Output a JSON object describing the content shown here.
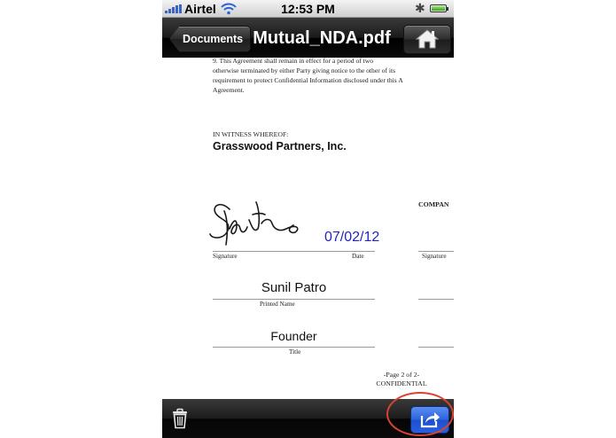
{
  "status_bar": {
    "carrier": "Airtel",
    "time": "12:53 PM"
  },
  "nav": {
    "back_label": "Documents",
    "title": "Mutual_NDA.pdf"
  },
  "document": {
    "clause_lines": [
      "9.        This Agreement shall remain in effect for a period of two",
      "otherwise terminated by either Party giving notice to the other of its",
      "requirement to protect Confidential Information disclosed under this A",
      "Agreement."
    ],
    "witness": "IN WITNESS WHEREOF:",
    "company": "Grasswood Partners, Inc.",
    "counterparty_label": "COMPAN",
    "signature_date": "07/02/12",
    "signature_label": "Signature",
    "date_label": "Date",
    "signature_label_right": "Signature",
    "printed_name": "Sunil Patro",
    "printed_name_label": "Printed Name",
    "title_value": "Founder",
    "title_label": "Title",
    "page_number": "-Page 2 of 2-",
    "confidential": "CONFIDENTIAL"
  },
  "toolbar": {
    "trash_icon": "trash-icon",
    "share_icon": "share-icon"
  },
  "colors": {
    "date_blue": "#2324c4",
    "highlight_red": "#d9432f",
    "share_blue": "#2c62de"
  }
}
